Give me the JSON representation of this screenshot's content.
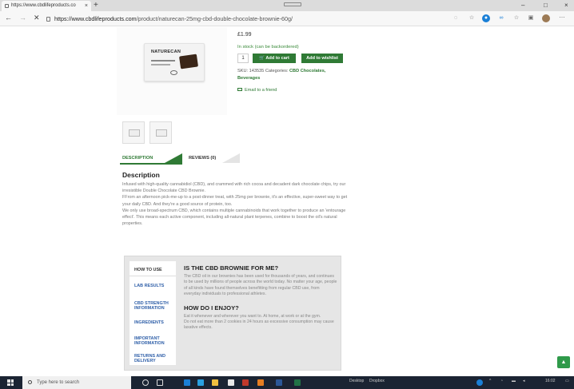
{
  "browser": {
    "tab_title": "https://www.cbdlifeproducts.co",
    "tab_close": "×",
    "new_tab": "+",
    "url_domain": "https://www.cbdlifeproducts.com",
    "url_path": "/product/naturecan-25mg-cbd-double-chocolate-brownie-60g/",
    "back": "←",
    "forward": "→",
    "stop": "✕",
    "win_minimize": "–",
    "win_restore": "□",
    "win_close": "×"
  },
  "product": {
    "brand": "NATURECAN",
    "price": "£1.99",
    "stock": "In stock (can be backordered)",
    "qty": "1",
    "add_to_cart": "Add to cart",
    "add_to_wishlist": "Add to wishlist",
    "sku_label": "SKU: 143535",
    "categories_label": "Categories:",
    "cat1": "CBD Chocolates,",
    "cat2": "Beverages",
    "email_friend": "Email to a friend"
  },
  "tabs": {
    "description": "DESCRIPTION",
    "reviews": "REVIEWS (0)"
  },
  "description": {
    "heading": "Description",
    "p1": "Infused with high-quality cannabidiol (CBD), and crammed with rich cocoa and decadent dark chocolate chips, try our irresistible Double Chocolate CBD Brownie.",
    "p2": "FFrom an afternoon pick-me-up to a post-dinner treat, with 25mg per brownie, it's an effective, super-sweet way to get your daily CBD. And they're a good source of protein, too.",
    "p3": "We only use broad-spectrum CBD, which contains multiple cannabinoids that work together to produce an 'entourage effect'. This means each active component, including all-natural plant terpenes, combine to boost the oil's natural properties."
  },
  "info": {
    "side": [
      "HOW TO USE",
      "LAB RESULTS",
      "CBD STRENGTH INFORMATION",
      "INGREDIENTS",
      "IMPORTANT INFORMATION",
      "RETURNS AND DELIVERY"
    ],
    "h1": "IS THE CBD BROWNIE FOR ME?",
    "p1": "The CBD oil in our brownies has been used for thousands of years, and continues to be used by millions of people across the world today. No matter your age, people of all kinds have found themselves benefitting from regular CBD use, from everyday individuals to professional athletes.",
    "h2": "HOW DO I ENJOY?",
    "p2": "Eat it whenever and wherever you want to. At home, at work or at the gym.",
    "p3": "Do not eat more than 2 cookies in 24 hours as excessive consumption may cause laxative effects."
  },
  "taskbar": {
    "search_placeholder": "Type here to search",
    "desktop_label": "Desktop",
    "dropbox_label": "Dropbox",
    "clock": "16:02"
  }
}
